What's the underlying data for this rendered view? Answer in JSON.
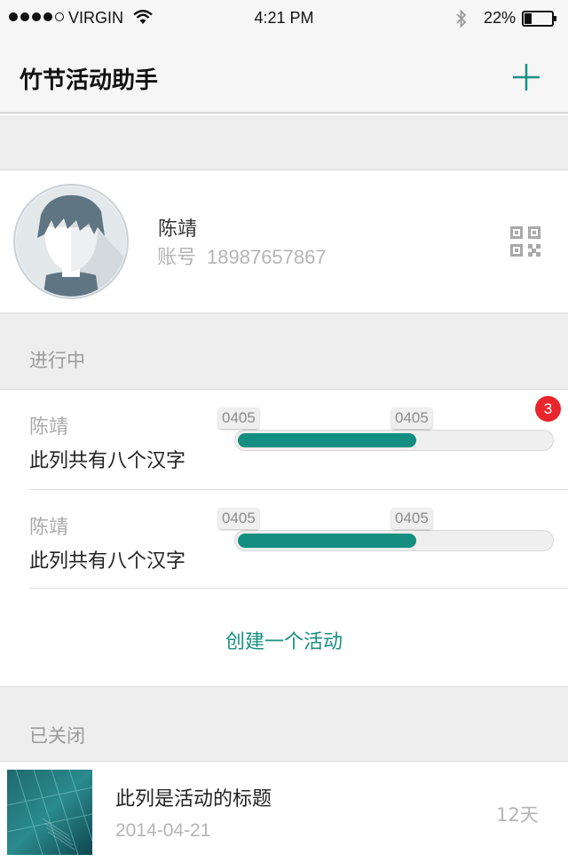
{
  "status_bar": {
    "carrier": "VIRGIN",
    "time": "4:21 PM",
    "battery": "22%",
    "icons": [
      "signal-dots-icon",
      "wifi-icon",
      "bluetooth-icon",
      "battery-icon"
    ]
  },
  "nav": {
    "title": "竹节活动助手",
    "add_icon": "plus-icon",
    "accent_color": "#17907f"
  },
  "profile": {
    "name": "陈靖",
    "account_label": "账号",
    "account_number": "18987657867",
    "qr_icon": "qr-code-icon"
  },
  "in_progress": {
    "label": "进行中",
    "items": [
      {
        "author": "陈靖",
        "title": "此列共有八个汉字",
        "start_tag": "0405",
        "end_tag": "0405",
        "progress": 0.57,
        "badge": "3"
      },
      {
        "author": "陈靖",
        "title": "此列共有八个汉字",
        "start_tag": "0405",
        "end_tag": "0405",
        "progress": 0.57
      }
    ],
    "create_label": "创建一个活动",
    "progress_color": "#138e80",
    "badge_color": "#e8262b"
  },
  "closed": {
    "label": "已关闭",
    "items": [
      {
        "title": "此列是活动的标题",
        "date": "2014-04-21",
        "days": "12天"
      }
    ]
  }
}
